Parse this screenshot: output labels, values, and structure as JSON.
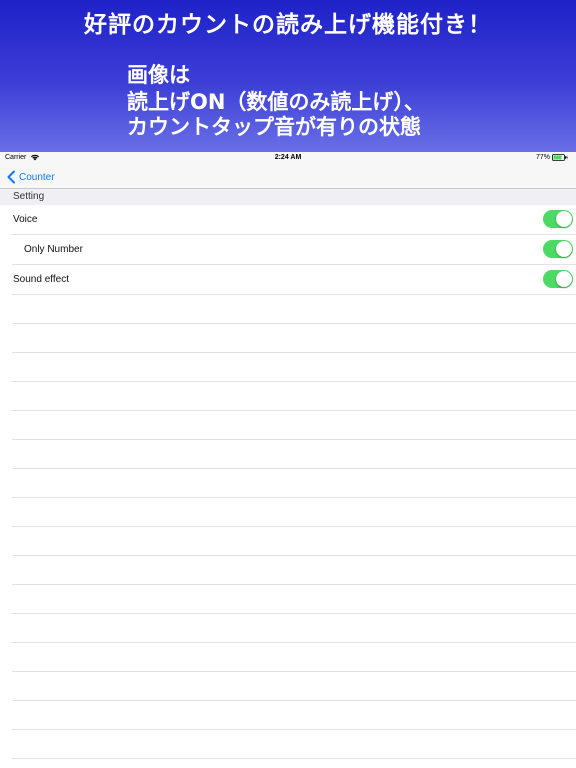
{
  "promo": {
    "headline": "好評のカウントの読み上げ機能付き！",
    "line1": "画像は",
    "line2": "読上げON（数値のみ読上げ）、",
    "line3": "カウントタップ音が有りの状態"
  },
  "status_bar": {
    "carrier": "Carrier",
    "time": "2:24 AM",
    "battery": "77%"
  },
  "nav": {
    "back_label": "Counter"
  },
  "section": {
    "title": "Setting"
  },
  "settings": [
    {
      "label": "Voice",
      "enabled": true
    },
    {
      "label": "Only Number",
      "enabled": true
    },
    {
      "label": "Sound effect",
      "enabled": true
    }
  ],
  "colors": {
    "accent": "#0a7aff",
    "switch_on": "#4cd964",
    "promo_bg": "#2a2ed0"
  },
  "icons": {
    "back": "chevron-left-icon",
    "wifi": "wifi-icon",
    "battery": "battery-icon"
  }
}
